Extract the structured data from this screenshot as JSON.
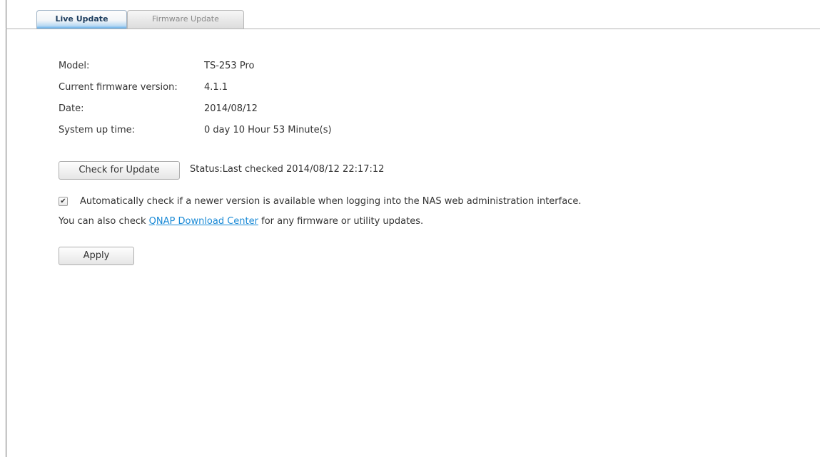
{
  "tabs": [
    {
      "label": "Live Update",
      "active": true
    },
    {
      "label": "Firmware Update",
      "active": false
    }
  ],
  "info": {
    "model_label": "Model:",
    "model_value": "TS-253 Pro",
    "firmware_label": "Current firmware version:",
    "firmware_value": "4.1.1",
    "date_label": "Date:",
    "date_value": "2014/08/12",
    "uptime_label": "System up time:",
    "uptime_value": "0 day 10 Hour 53 Minute(s)"
  },
  "check_update": {
    "button_label": "Check for Update",
    "status_text": "Status:Last checked 2014/08/12 22:17:12"
  },
  "auto_check": {
    "checked": true,
    "check_glyph": "✔",
    "label": "Automatically check if a newer version is available when logging into the NAS web administration interface."
  },
  "download_note": {
    "prefix": "You can also check ",
    "link_text": "QNAP Download Center",
    "suffix": " for any firmware or utility updates."
  },
  "apply_label": "Apply",
  "colors": {
    "link": "#1a8ad6",
    "active_tab_accent": "#5ba9e6"
  }
}
